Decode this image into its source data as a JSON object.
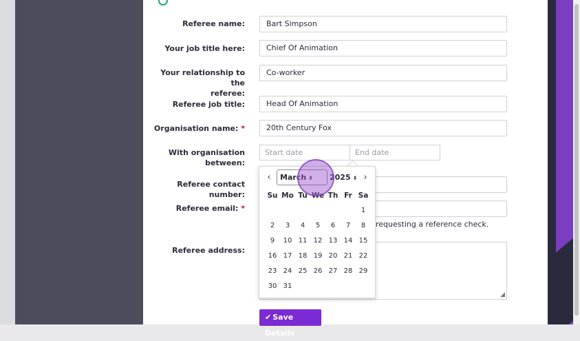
{
  "form": {
    "referee_name": {
      "label": "Referee name:",
      "value": "Bart Simpson"
    },
    "job_title": {
      "label": "Your job title here:",
      "value": "Chief Of Animation"
    },
    "relationship": {
      "label_line1": "Your relationship to the",
      "label_line2": "referee:",
      "value": "Co-worker"
    },
    "referee_job_title": {
      "label": "Referee job title:",
      "value": "Head Of Animation"
    },
    "organisation_name": {
      "label": "Organisation name:",
      "required_mark": "*",
      "value": "20th Century Fox"
    },
    "with_org": {
      "label_line1": "With organisation",
      "label_line2": "between:",
      "start_placeholder": "Start date",
      "end_placeholder": "End date"
    },
    "contact_number": {
      "label": "Referee contact number:"
    },
    "email": {
      "label": "Referee email:",
      "required_mark": "*",
      "help_text": "requesting a reference check."
    },
    "address": {
      "label": "Referee address:"
    },
    "save_button": {
      "icon": "check-icon",
      "label": "Save Details"
    }
  },
  "calendar": {
    "prev_icon": "‹",
    "next_icon": "›",
    "month": "March",
    "year": "2025",
    "weekdays": [
      "Su",
      "Mo",
      "Tu",
      "We",
      "Th",
      "Fr",
      "Sa"
    ],
    "days": [
      "",
      "",
      "",
      "",
      "",
      "",
      "1",
      "2",
      "3",
      "4",
      "5",
      "6",
      "7",
      "8",
      "9",
      "10",
      "11",
      "12",
      "13",
      "14",
      "15",
      "16",
      "17",
      "18",
      "19",
      "20",
      "21",
      "22",
      "23",
      "24",
      "25",
      "26",
      "27",
      "28",
      "29",
      "30",
      "31",
      "",
      "",
      "",
      "",
      ""
    ]
  },
  "colors": {
    "accent": "#7b2bd3",
    "required": "#c0142b",
    "sidebar": "#4b4d5d"
  }
}
